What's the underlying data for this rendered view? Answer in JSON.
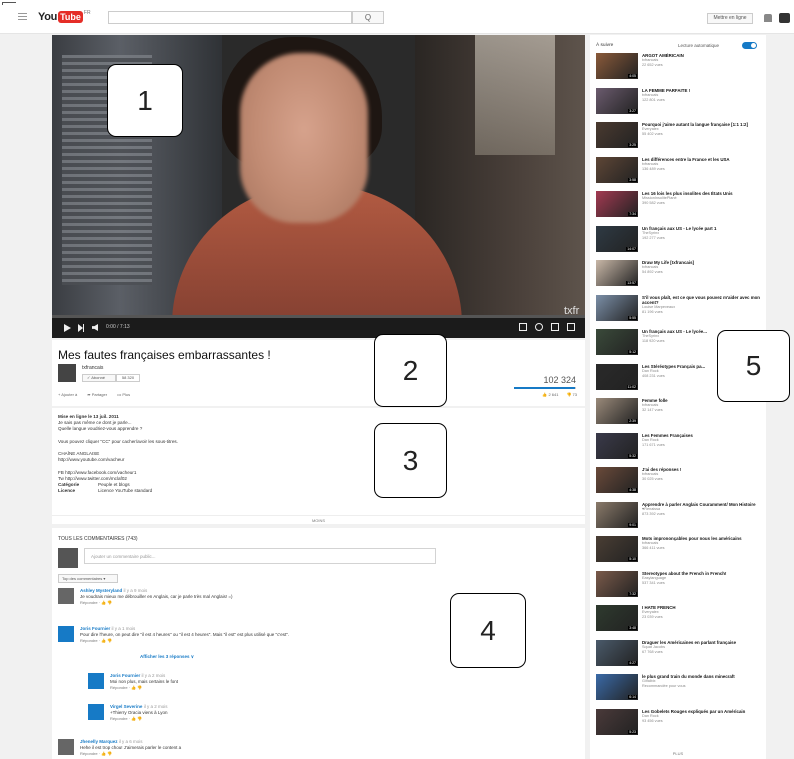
{
  "header": {
    "logo_you": "You",
    "logo_tube": "Tube",
    "logo_country": "FR",
    "search_button": "Q",
    "upload_label": "Mettre en ligne"
  },
  "player": {
    "watermark": "txfr",
    "time": "0:00 / 7:13",
    "progress": 0.0
  },
  "callouts": [
    "1",
    "2",
    "3",
    "4",
    "5"
  ],
  "video": {
    "title": "Mes fautes françaises embarrassantes !",
    "channel": "txfrancais",
    "subscribe_label": "✓ Abonné",
    "subscriber_count": "58 320",
    "views": "102 324",
    "like_ratio": 0.98,
    "actions": [
      "+ Ajouter à",
      "➦ Partager",
      "••• Plus"
    ],
    "likes": "2 641",
    "dislikes": "73"
  },
  "description": {
    "published": "Mise en ligne le 13 juil. 2011",
    "lines": [
      "Je sais pas même ce dont je parle...",
      "Quelle langue voudriez-vous apprendre ?",
      "",
      "Vous pouvez cliquer \"CC\" pour cacher/avoir les sous-titres.",
      "",
      "CHAÎNE ANGLAISE",
      "http://www.youtube.com/vacheur",
      "",
      "FB http://www.facebook.com/vacheur1",
      "Tw http://www.twitter.com/mclaf02"
    ],
    "category_label": "Catégorie",
    "category_value": "Peuple et blogs",
    "license_label": "Licence",
    "license_value": "Licence YouTube standard",
    "more": "MOINS"
  },
  "comments": {
    "heading": "TOUS LES COMMENTAIRES (743)",
    "placeholder": "Ajouter un commentaire public...",
    "sort_label": "Top des commentaires ▾",
    "show_replies": "Afficher les 3 réponses ∨",
    "reply_label": "Répondre · 👍 👎",
    "items": [
      {
        "author": "Ashley Mysteryland",
        "time": "il y a 9 mois",
        "text": "Je voudrais mieux me débrouiller en Anglais, car je parle très mal Anglais! =)"
      },
      {
        "author": "Joris Fournier",
        "time": "il y a 1 mois",
        "text": "Pour dire l'heure, on peut dire \"il est 4 heures\" ou \"il est 4 heures\". Mais \"il est\" est plus utilisé que \"c'est\"."
      },
      {
        "author": "Joris Fournier",
        "time": "il y a 2 mois",
        "text": "Moi non plus, mais certains le font"
      },
      {
        "author": "Virgel Severine",
        "time": "il y a 2 mois",
        "text": "+Thierry Oracia viens à Lyon"
      },
      {
        "author": "Jhenelly Marquez",
        "time": "il y a 6 mois",
        "text": "Hehe il est trop chou! J'aimerais parler le content a"
      }
    ]
  },
  "sidebar": {
    "heading": "À suivre",
    "autoplay": "Lecture automatique",
    "more": "PLUS",
    "items": [
      {
        "title": "ARGOT AMÉRICAIN",
        "channel": "txfrancais",
        "views": "22 652 vues",
        "duration": "4:05",
        "color": "#8a5a3a"
      },
      {
        "title": "LA FEMME PARFAITE !",
        "channel": "txfrancais",
        "views": "122 801 vues",
        "duration": "3:27",
        "color": "#6b5b6e"
      },
      {
        "title": "Pourquoi j'aime autant la langue française [1:1 1:2]",
        "channel": "Everyalex",
        "views": "55 402 vues",
        "duration": "3:25",
        "color": "#4a3a30"
      },
      {
        "title": "Les différences entre la France et les USA",
        "channel": "txfrancais",
        "views": "136 489 vues",
        "duration": "3:58",
        "color": "#5e4636"
      },
      {
        "title": "Les 16 lois les plus insolites des États Unis",
        "channel": "MissionInsolitePlanè",
        "views": "390 582 vues",
        "duration": "7:34",
        "color": "#a33a52"
      },
      {
        "title": "Un français aux US - Le lycée part 1",
        "channel": "TheSyrinx",
        "views": "192 277 vues",
        "duration": "14:07",
        "color": "#2e3a44"
      },
      {
        "title": "Draw My Life [txfrancais]",
        "channel": "txfrancais",
        "views": "54 892 vues",
        "duration": "13:57",
        "color": "#c9b8a8"
      },
      {
        "title": "S'il vous plaît, est ce que vous pouvez m'aider avec mon accent?",
        "channel": "Louise Marpeveaux",
        "views": "81 196 vues",
        "duration": "5:55",
        "color": "#7b8fa8"
      },
      {
        "title": "Un français aux US - Le lycée...",
        "channel": "TheSyrinx",
        "views": "118 920 vues",
        "duration": "5:12",
        "color": "#3a4a3a"
      },
      {
        "title": "Les Stéréotypes Français pa...",
        "channel": "Dan Rock",
        "views": "408 231 vues",
        "duration": "11:02",
        "color": "#2a2a2a"
      },
      {
        "title": "Femme folle",
        "channel": "txfrancais",
        "views": "32 147 vues",
        "duration": "2:39",
        "color": "#9a8a7a"
      },
      {
        "title": "Les Femmes Françaises",
        "channel": "Dan Rock",
        "views": "171 671 vues",
        "duration": "5:32",
        "color": "#3a3a4a"
      },
      {
        "title": "J'ai des réponses !",
        "channel": "txfrancais",
        "views": "30 025 vues",
        "duration": "4:38",
        "color": "#6a4a3a"
      },
      {
        "title": "Apprendre à parler Anglais Couramment/ Mon Histoire",
        "channel": "♥Renaissa",
        "views": "873 392 vues",
        "duration": "9:01",
        "color": "#8a7a6a"
      },
      {
        "title": "Mots imprononçables pour nous les américains",
        "channel": "txfrancais",
        "views": "366 411 vues",
        "duration": "5:10",
        "color": "#4a3e34"
      },
      {
        "title": "Stereotypes about the French in French!",
        "channel": "Easylanguage",
        "views": "537 341 vues",
        "duration": "7:32",
        "color": "#7a5a4a"
      },
      {
        "title": "I HATE FRENCH",
        "channel": "Everyalex",
        "views": "23 039 vues",
        "duration": "3:48",
        "color": "#2e3a2e"
      },
      {
        "title": "Draguer les Américaines en parlant française",
        "channel": "Squat Jacobs",
        "views": "67 768 vues",
        "duration": "4:27",
        "color": "#4a5a6a"
      },
      {
        "title": "le plus grand train du monde dans minecraft",
        "channel": "Gilfalbix",
        "views": "Recommandée pour vous",
        "duration": "6:14",
        "color": "#3a6aa8"
      },
      {
        "title": "Les Gobelets Rouges expliqués par un Américain",
        "channel": "Dan Rock",
        "views": "93 456 vues",
        "duration": "5:23",
        "color": "#4a3a3a"
      }
    ]
  }
}
